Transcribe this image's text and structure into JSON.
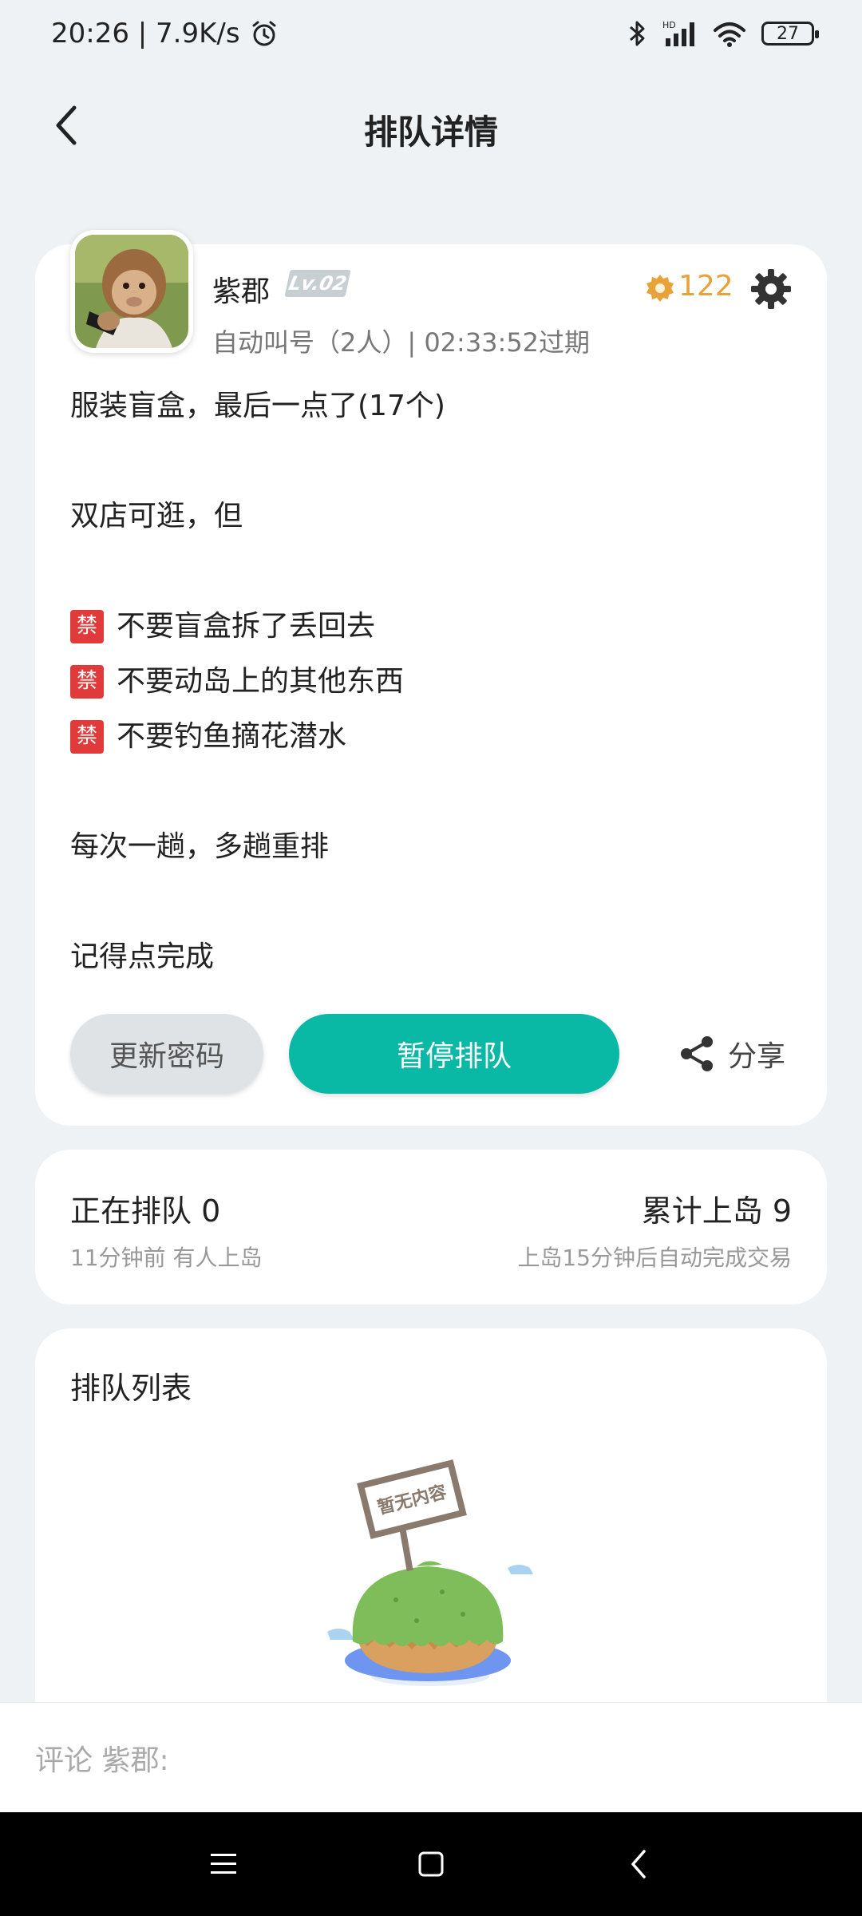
{
  "status_bar": {
    "time_speed": "20:26 | 7.9K/s",
    "battery": "27",
    "network_label": "HD"
  },
  "header": {
    "title": "排队详情"
  },
  "post": {
    "user_name": "紫郡",
    "level": "Lv.02",
    "sub_info": "自动叫号（2人）| 02:33:52过期",
    "coin_count": "122",
    "lines": [
      "服装盲盒，最后一点了(17个)",
      "",
      "双店可逛，但",
      "",
      "不要盲盒拆了丢回去",
      "不要动岛上的其他东西",
      "不要钓鱼摘花潜水",
      "",
      "每次一趟，多趟重排",
      "",
      "记得点完成"
    ],
    "ban_label": "禁",
    "btn_update": "更新密码",
    "btn_pause": "暂停排队",
    "btn_share": "分享"
  },
  "stats": {
    "queue_title": "正在排队 0",
    "queue_sub": "11分钟前 有人上岛",
    "total_title": "累计上岛 9",
    "total_sub": "上岛15分钟后自动完成交易"
  },
  "queue_list": {
    "title": "排队列表",
    "empty_sign": "暂无内容"
  },
  "comment": {
    "placeholder": "评论 紫郡:"
  },
  "colors": {
    "accent": "#0ab8a6",
    "coin": "#e8a23a",
    "ban": "#e03a3a",
    "background": "#eef2f5"
  },
  "icons": [
    "back-icon",
    "coin-icon",
    "gear-icon",
    "share-icon",
    "menu-icon",
    "home-icon",
    "back-nav-icon"
  ]
}
